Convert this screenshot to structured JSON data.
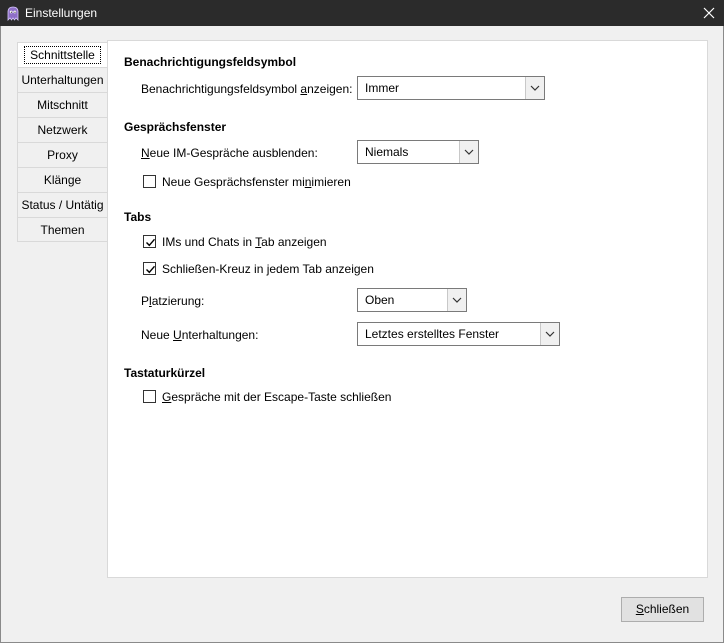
{
  "window": {
    "title": "Einstellungen",
    "icon": "app-ghost-icon",
    "close_icon": "close-icon"
  },
  "sidebar": {
    "tabs": [
      {
        "label": "Schnittstelle",
        "selected": true
      },
      {
        "label": "Unterhaltungen",
        "selected": false
      },
      {
        "label": "Mitschnitt",
        "selected": false
      },
      {
        "label": "Netzwerk",
        "selected": false
      },
      {
        "label": "Proxy",
        "selected": false
      },
      {
        "label": "Klänge",
        "selected": false
      },
      {
        "label": "Status / Untätig",
        "selected": false
      },
      {
        "label": "Themen",
        "selected": false
      }
    ]
  },
  "notification": {
    "title": "Benachrichtigungsfeldsymbol",
    "show_label_pre": "Benachrichtigungsfeldsymbol ",
    "show_label_key": "a",
    "show_label_post": "nzeigen:",
    "show_value": "Immer"
  },
  "conversation": {
    "title": "Gesprächsfenster",
    "hide_label_key": "N",
    "hide_label_post": "eue IM-Gespräche ausblenden:",
    "hide_value": "Niemals",
    "minimize_label_pre": "Neue Gesprächsfenster mi",
    "minimize_label_key": "n",
    "minimize_label_post": "imieren",
    "minimize_checked": false
  },
  "tabs_section": {
    "title": "Tabs",
    "ims_label_pre": "IMs und Chats in ",
    "ims_label_key": "T",
    "ims_label_post": "ab anzeigen",
    "ims_checked": true,
    "close_label": "Schließen-Kreuz in jedem Tab anzeigen",
    "close_checked": true,
    "placement_label_pre": "P",
    "placement_label_key": "l",
    "placement_label_post": "atzierung:",
    "placement_value": "Oben",
    "new_conv_label_pre": "Neue ",
    "new_conv_label_key": "U",
    "new_conv_label_post": "nterhaltungen:",
    "new_conv_value": "Letztes erstelltes Fenster"
  },
  "shortcuts": {
    "title": "Tastaturkürzel",
    "escape_label_key": "G",
    "escape_label_post": "espräche mit der Escape-Taste schließen",
    "escape_checked": false
  },
  "footer": {
    "close_key": "S",
    "close_post": "chließen"
  }
}
